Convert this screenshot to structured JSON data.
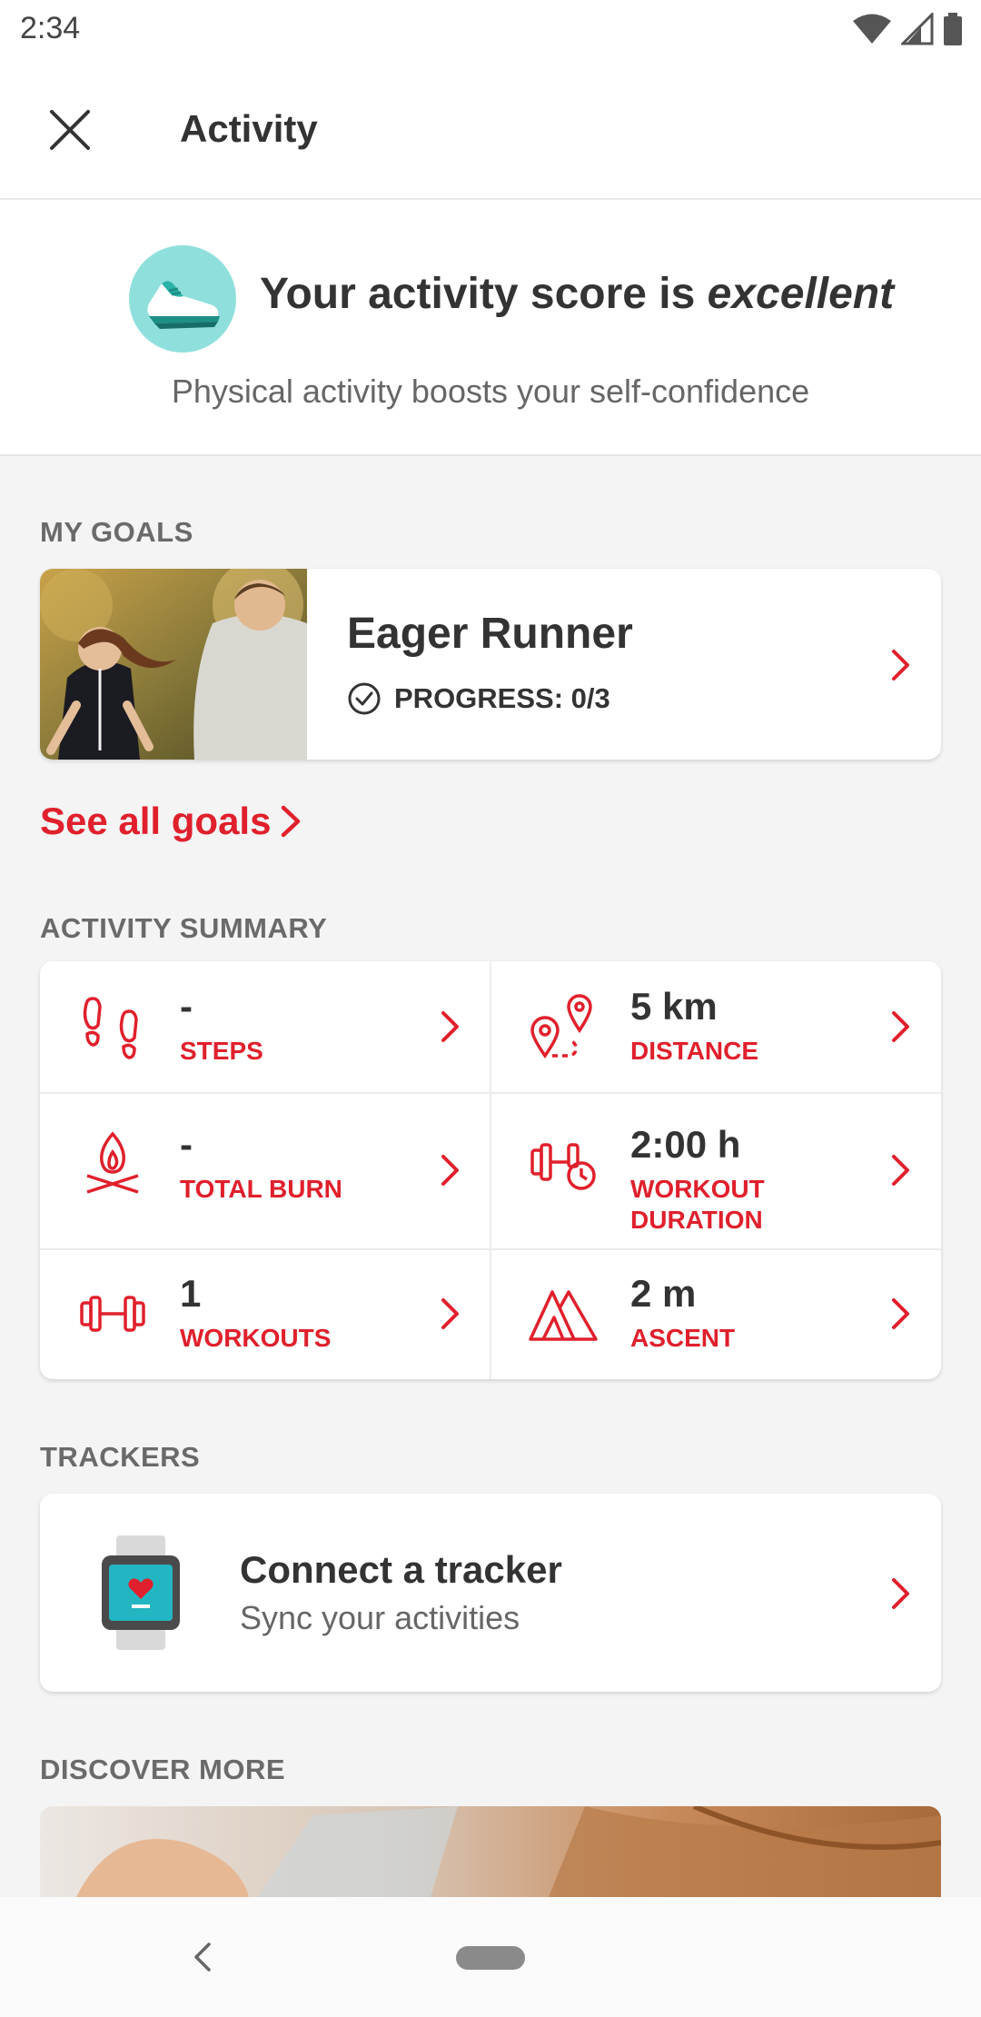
{
  "status_bar": {
    "time": "2:34"
  },
  "app_bar": {
    "title": "Activity"
  },
  "hero": {
    "score_prefix": "Your activity score is ",
    "score_value": "excellent",
    "subtitle": "Physical activity boosts your self-confidence"
  },
  "goals": {
    "section_label": "MY GOALS",
    "card": {
      "title": "Eager Runner",
      "progress": "PROGRESS: 0/3"
    },
    "see_all": "See all goals"
  },
  "summary": {
    "section_label": "ACTIVITY SUMMARY",
    "items": [
      {
        "value": "-",
        "label": "STEPS",
        "icon": "footsteps-icon"
      },
      {
        "value": "5 km",
        "label": "DISTANCE",
        "icon": "route-pin-icon"
      },
      {
        "value": "-",
        "label": "TOTAL BURN",
        "icon": "campfire-icon"
      },
      {
        "value": "2:00 h",
        "label_line1": "WORKOUT",
        "label_line2": "DURATION",
        "icon": "dumbbell-timer-icon"
      },
      {
        "value": "1",
        "label": "WORKOUTS",
        "icon": "dumbbell-icon"
      },
      {
        "value": "2 m",
        "label": "ASCENT",
        "icon": "mountains-icon"
      }
    ]
  },
  "trackers": {
    "section_label": "TRACKERS",
    "title": "Connect a tracker",
    "subtitle": "Sync your activities"
  },
  "discover": {
    "section_label": "DISCOVER MORE"
  },
  "colors": {
    "accent": "#e0202c",
    "teal": "#8fe0dc",
    "background": "#f4f4f4"
  }
}
